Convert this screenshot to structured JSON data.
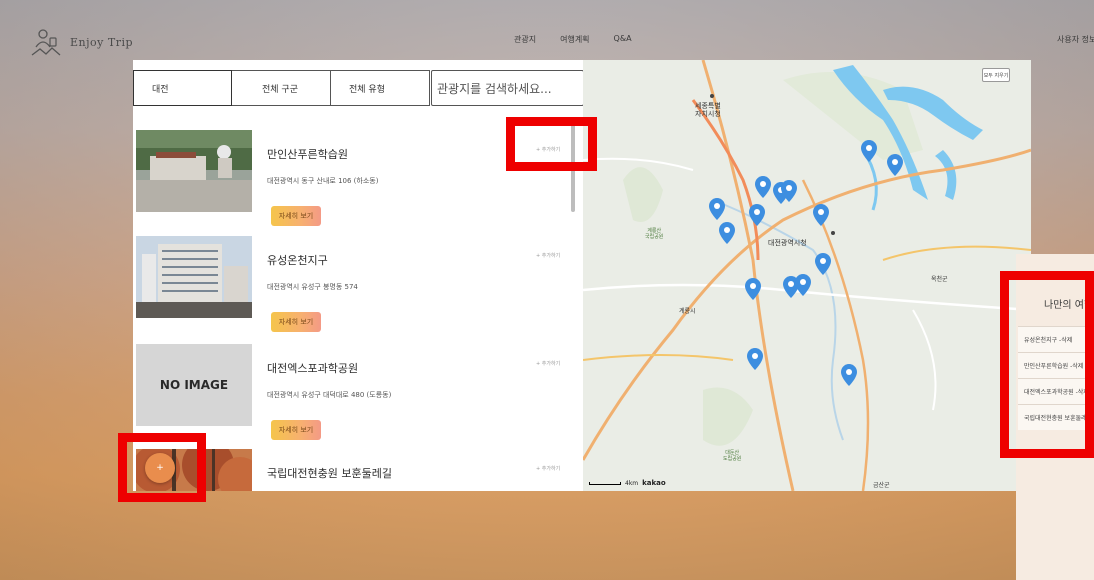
{
  "brand": {
    "name": "Enjoy Trip"
  },
  "nav": {
    "links": [
      "관광지",
      "여행계획",
      "Q&A"
    ],
    "user": "사용자 정보"
  },
  "filters": {
    "region": "대전",
    "district": "전체 구군",
    "type": "전체 유형",
    "search_placeholder": "관광지를 검색하세요..."
  },
  "list": {
    "detail_label": "자세히 보기",
    "add_label": "+ 추가하기",
    "no_image_text": "NO IMAGE",
    "items": [
      {
        "title": "만인산푸른학습원",
        "address": "대전광역시 동구 산내로 106 (하소동)"
      },
      {
        "title": "유성온천지구",
        "address": "대전광역시 유성구 봉명동 574"
      },
      {
        "title": "대전엑스포과학공원",
        "address": "대전광역시 유성구 대덕대로 480 (도룡동)"
      },
      {
        "title": "국립대전현충원 보훈둘레길",
        "address": ""
      }
    ]
  },
  "map": {
    "reset_button": "모두 지우기",
    "labels": {
      "sejong": "세종특별\n자치시청",
      "city_hall": "대전광역시청",
      "gyeryong": "계룡산\n국립공원",
      "daedun": "대둔산\n도립공원",
      "geumsan": "금산군",
      "okcheon": "옥천군",
      "gyeryong_city": "계룡시"
    },
    "scale": "4km",
    "provider": "kakao",
    "pin_color": "#3d8ee0"
  },
  "plan_panel": {
    "title": "나만의 여행 계획",
    "items": [
      "유성온천지구 -삭제",
      "만인산푸른학습원 -삭제",
      "대전엑스포과학공원 -삭제",
      "국립대전현충원 보훈둘레길 -삭제"
    ]
  },
  "fab": {
    "label": "+"
  },
  "colors": {
    "highlight": "#ee0000",
    "detail_start": "#f5c54b",
    "detail_end": "#f49a86",
    "fab": "#e98d4d"
  }
}
